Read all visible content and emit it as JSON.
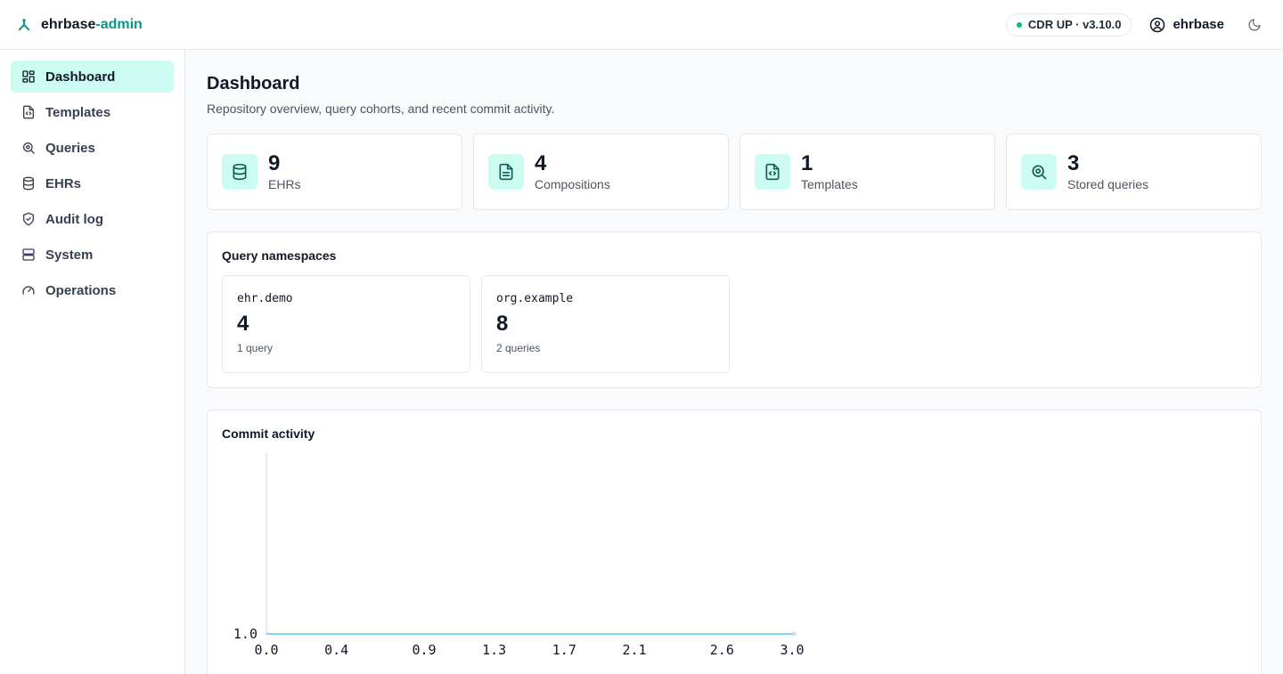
{
  "app": {
    "brand_prefix": "ehrbase",
    "brand_suffix": "-admin"
  },
  "header": {
    "status": "CDR UP · v3.10.0",
    "user": "ehrbase"
  },
  "sidebar": {
    "items": [
      {
        "label": "Dashboard",
        "icon": "dashboard-icon",
        "active": true
      },
      {
        "label": "Templates",
        "icon": "template-file-icon"
      },
      {
        "label": "Queries",
        "icon": "search-icon"
      },
      {
        "label": "EHRs",
        "icon": "database-icon"
      },
      {
        "label": "Audit log",
        "icon": "shield-icon"
      },
      {
        "label": "System",
        "icon": "server-icon"
      },
      {
        "label": "Operations",
        "icon": "gauge-icon"
      }
    ]
  },
  "page": {
    "title": "Dashboard",
    "subtitle": "Repository overview, query cohorts, and recent commit activity."
  },
  "stats": [
    {
      "value": "9",
      "label": "EHRs",
      "icon": "database-icon"
    },
    {
      "value": "4",
      "label": "Compositions",
      "icon": "document-icon"
    },
    {
      "value": "1",
      "label": "Templates",
      "icon": "template-file-icon"
    },
    {
      "value": "3",
      "label": "Stored queries",
      "icon": "search-icon"
    }
  ],
  "namespaces": {
    "title": "Query namespaces",
    "items": [
      {
        "name": "ehr.demo",
        "count": "4",
        "sub": "1 query"
      },
      {
        "name": "org.example",
        "count": "8",
        "sub": "2 queries"
      }
    ]
  },
  "commit_activity": {
    "title": "Commit activity"
  },
  "chart_data": {
    "type": "line",
    "x": [
      0.0,
      3.0
    ],
    "values": [
      1.0,
      1.0
    ],
    "x_ticks": [
      "0.0",
      "0.4",
      "0.9",
      "1.3",
      "1.7",
      "2.1",
      "2.6",
      "3.0"
    ],
    "y_ticks": [
      "1.0"
    ],
    "xlim": [
      0.0,
      3.0
    ],
    "ylim": [
      1.0,
      1.0
    ],
    "color": "#7dd3fc",
    "grid": false
  }
}
